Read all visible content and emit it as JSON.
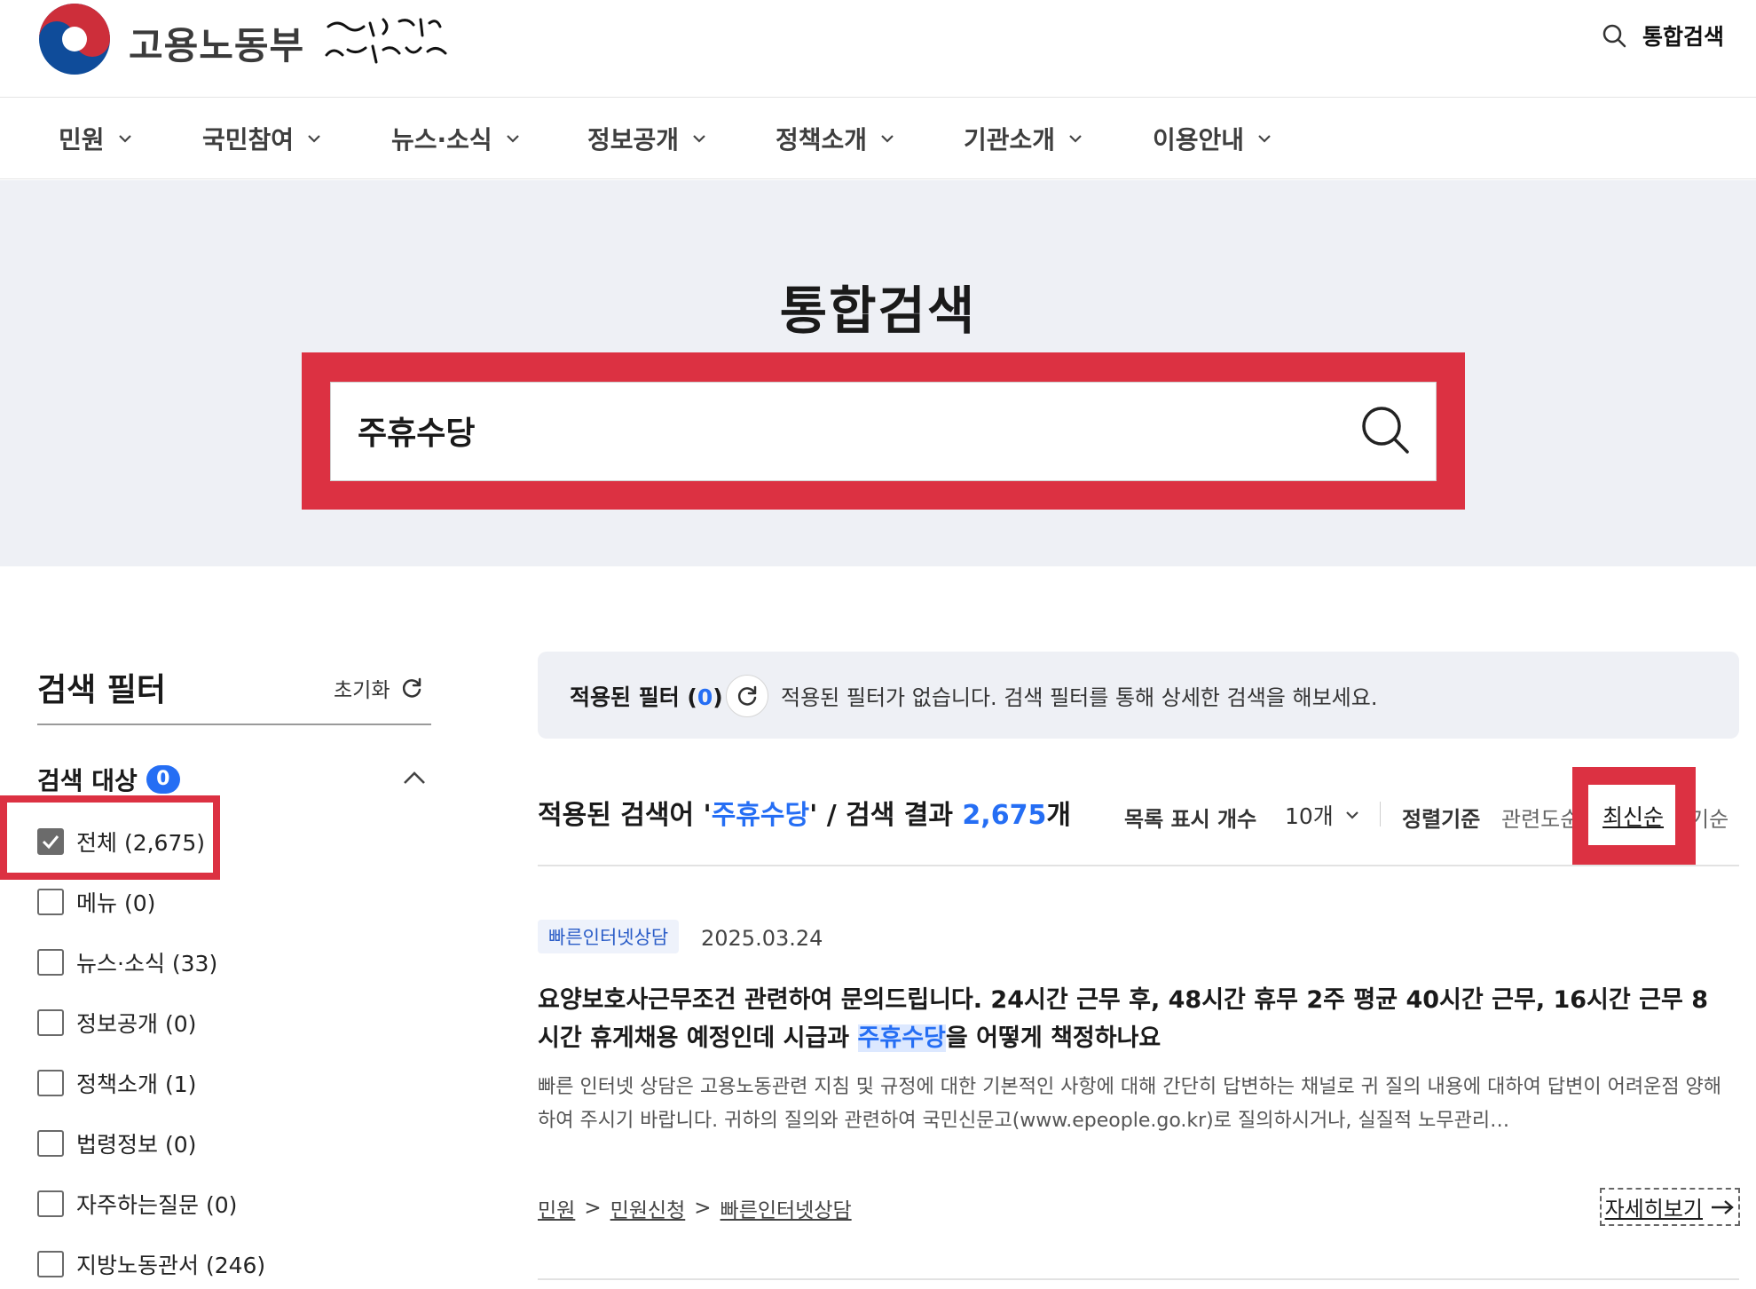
{
  "header": {
    "org_name": "고용노동부",
    "slogan": "다시 대한민국! 새로운 국민의 나라",
    "search_link_label": "통합검색"
  },
  "nav": [
    {
      "label": "민원"
    },
    {
      "label": "국민참여"
    },
    {
      "label": "뉴스·소식"
    },
    {
      "label": "정보공개"
    },
    {
      "label": "정책소개"
    },
    {
      "label": "기관소개"
    },
    {
      "label": "이용안내"
    }
  ],
  "hero": {
    "title": "통합검색",
    "search_value": "주휴수당"
  },
  "filter": {
    "title": "검색 필터",
    "reset_label": "초기화",
    "target_heading": "검색 대상",
    "target_badge": "0",
    "options": [
      {
        "label": "전체 (2,675)",
        "checked": true
      },
      {
        "label": "메뉴 (0)",
        "checked": false
      },
      {
        "label": "뉴스·소식 (33)",
        "checked": false
      },
      {
        "label": "정보공개 (0)",
        "checked": false
      },
      {
        "label": "정책소개 (1)",
        "checked": false
      },
      {
        "label": "법령정보 (0)",
        "checked": false
      },
      {
        "label": "자주하는질문 (0)",
        "checked": false
      },
      {
        "label": "지방노동관서 (246)",
        "checked": false
      }
    ]
  },
  "applied": {
    "label_prefix": "적용된 필터 (",
    "count": "0",
    "label_suffix": ")",
    "message": "적용된 필터가 없습니다. 검색 필터를 통해 상세한 검색을 해보세요."
  },
  "summary": {
    "prefix": "적용된 검색어 '",
    "keyword": "주휴수당",
    "middle": "' / 검색 결과 ",
    "count": "2,675",
    "suffix": "개",
    "list_count_label": "목록 표시 개수",
    "list_count_value": "10개",
    "sort_label": "정렬기준",
    "sort_options": [
      "관련도순",
      "최신순",
      "인기순"
    ],
    "sort_active": "최신순",
    "sort_left_visible": "관련도순",
    "sort_right_visible": "기순"
  },
  "result": {
    "category": "빠른인터넷상담",
    "date": "2025.03.24",
    "title_before": "요양보호사근무조건 관련하여 문의드립니다. 24시간 근무 후, 48시간 휴무 2주 평균 40시간 근무, 16시간 근무 8시간 휴게채용 예정인데 시급과 ",
    "title_keyword": "주휴수당",
    "title_after": "을 어떻게 책정하나요",
    "description": "빠른 인터넷 상담은 고용노동관련 지침 및 규정에 대한 기본적인 사항에 대해 간단히 답변하는 채널로 귀 질의 내용에 대하여 답변이 어려운점 양해하여 주시기 바랍니다. 귀하의 질의와 관련하여 국민신문고(www.epeople.go.kr)로 질의하시거나, 실질적 노무관리…",
    "path": [
      "민원",
      "민원신청",
      "빠른인터넷상담"
    ],
    "path_separator": ">",
    "detail_label": "자세히보기"
  },
  "colors": {
    "accent_blue": "#256ef4",
    "highlight_red": "#dc3142",
    "hero_bg": "#eef0f5"
  },
  "icons": [
    "government-emblem-icon",
    "search-icon",
    "chevron-down-icon",
    "chevron-up-icon",
    "refresh-icon",
    "checkbox-checked-icon",
    "arrow-right-icon"
  ]
}
